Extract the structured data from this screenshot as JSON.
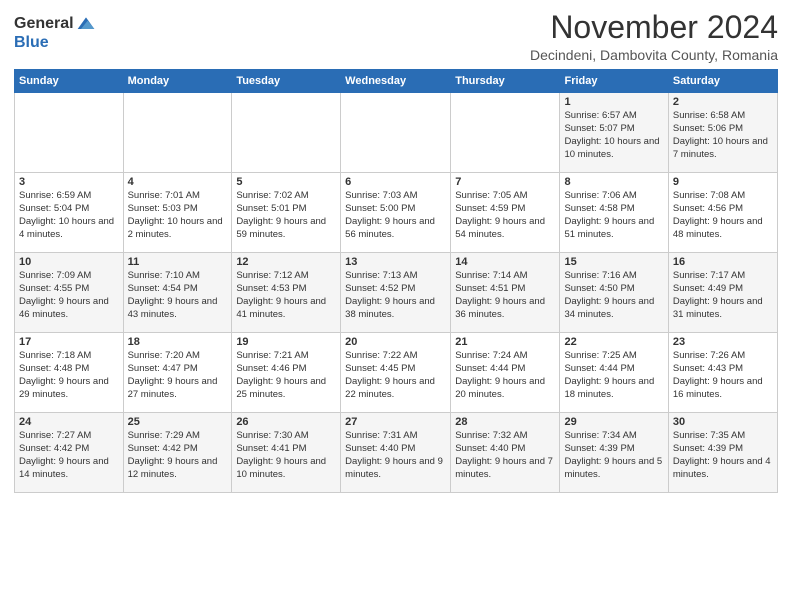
{
  "header": {
    "logo_general": "General",
    "logo_blue": "Blue",
    "month": "November 2024",
    "location": "Decindeni, Dambovita County, Romania"
  },
  "weekdays": [
    "Sunday",
    "Monday",
    "Tuesday",
    "Wednesday",
    "Thursday",
    "Friday",
    "Saturday"
  ],
  "weeks": [
    [
      {
        "day": "",
        "info": ""
      },
      {
        "day": "",
        "info": ""
      },
      {
        "day": "",
        "info": ""
      },
      {
        "day": "",
        "info": ""
      },
      {
        "day": "",
        "info": ""
      },
      {
        "day": "1",
        "info": "Sunrise: 6:57 AM\nSunset: 5:07 PM\nDaylight: 10 hours and 10 minutes."
      },
      {
        "day": "2",
        "info": "Sunrise: 6:58 AM\nSunset: 5:06 PM\nDaylight: 10 hours and 7 minutes."
      }
    ],
    [
      {
        "day": "3",
        "info": "Sunrise: 6:59 AM\nSunset: 5:04 PM\nDaylight: 10 hours and 4 minutes."
      },
      {
        "day": "4",
        "info": "Sunrise: 7:01 AM\nSunset: 5:03 PM\nDaylight: 10 hours and 2 minutes."
      },
      {
        "day": "5",
        "info": "Sunrise: 7:02 AM\nSunset: 5:01 PM\nDaylight: 9 hours and 59 minutes."
      },
      {
        "day": "6",
        "info": "Sunrise: 7:03 AM\nSunset: 5:00 PM\nDaylight: 9 hours and 56 minutes."
      },
      {
        "day": "7",
        "info": "Sunrise: 7:05 AM\nSunset: 4:59 PM\nDaylight: 9 hours and 54 minutes."
      },
      {
        "day": "8",
        "info": "Sunrise: 7:06 AM\nSunset: 4:58 PM\nDaylight: 9 hours and 51 minutes."
      },
      {
        "day": "9",
        "info": "Sunrise: 7:08 AM\nSunset: 4:56 PM\nDaylight: 9 hours and 48 minutes."
      }
    ],
    [
      {
        "day": "10",
        "info": "Sunrise: 7:09 AM\nSunset: 4:55 PM\nDaylight: 9 hours and 46 minutes."
      },
      {
        "day": "11",
        "info": "Sunrise: 7:10 AM\nSunset: 4:54 PM\nDaylight: 9 hours and 43 minutes."
      },
      {
        "day": "12",
        "info": "Sunrise: 7:12 AM\nSunset: 4:53 PM\nDaylight: 9 hours and 41 minutes."
      },
      {
        "day": "13",
        "info": "Sunrise: 7:13 AM\nSunset: 4:52 PM\nDaylight: 9 hours and 38 minutes."
      },
      {
        "day": "14",
        "info": "Sunrise: 7:14 AM\nSunset: 4:51 PM\nDaylight: 9 hours and 36 minutes."
      },
      {
        "day": "15",
        "info": "Sunrise: 7:16 AM\nSunset: 4:50 PM\nDaylight: 9 hours and 34 minutes."
      },
      {
        "day": "16",
        "info": "Sunrise: 7:17 AM\nSunset: 4:49 PM\nDaylight: 9 hours and 31 minutes."
      }
    ],
    [
      {
        "day": "17",
        "info": "Sunrise: 7:18 AM\nSunset: 4:48 PM\nDaylight: 9 hours and 29 minutes."
      },
      {
        "day": "18",
        "info": "Sunrise: 7:20 AM\nSunset: 4:47 PM\nDaylight: 9 hours and 27 minutes."
      },
      {
        "day": "19",
        "info": "Sunrise: 7:21 AM\nSunset: 4:46 PM\nDaylight: 9 hours and 25 minutes."
      },
      {
        "day": "20",
        "info": "Sunrise: 7:22 AM\nSunset: 4:45 PM\nDaylight: 9 hours and 22 minutes."
      },
      {
        "day": "21",
        "info": "Sunrise: 7:24 AM\nSunset: 4:44 PM\nDaylight: 9 hours and 20 minutes."
      },
      {
        "day": "22",
        "info": "Sunrise: 7:25 AM\nSunset: 4:44 PM\nDaylight: 9 hours and 18 minutes."
      },
      {
        "day": "23",
        "info": "Sunrise: 7:26 AM\nSunset: 4:43 PM\nDaylight: 9 hours and 16 minutes."
      }
    ],
    [
      {
        "day": "24",
        "info": "Sunrise: 7:27 AM\nSunset: 4:42 PM\nDaylight: 9 hours and 14 minutes."
      },
      {
        "day": "25",
        "info": "Sunrise: 7:29 AM\nSunset: 4:42 PM\nDaylight: 9 hours and 12 minutes."
      },
      {
        "day": "26",
        "info": "Sunrise: 7:30 AM\nSunset: 4:41 PM\nDaylight: 9 hours and 10 minutes."
      },
      {
        "day": "27",
        "info": "Sunrise: 7:31 AM\nSunset: 4:40 PM\nDaylight: 9 hours and 9 minutes."
      },
      {
        "day": "28",
        "info": "Sunrise: 7:32 AM\nSunset: 4:40 PM\nDaylight: 9 hours and 7 minutes."
      },
      {
        "day": "29",
        "info": "Sunrise: 7:34 AM\nSunset: 4:39 PM\nDaylight: 9 hours and 5 minutes."
      },
      {
        "day": "30",
        "info": "Sunrise: 7:35 AM\nSunset: 4:39 PM\nDaylight: 9 hours and 4 minutes."
      }
    ]
  ]
}
